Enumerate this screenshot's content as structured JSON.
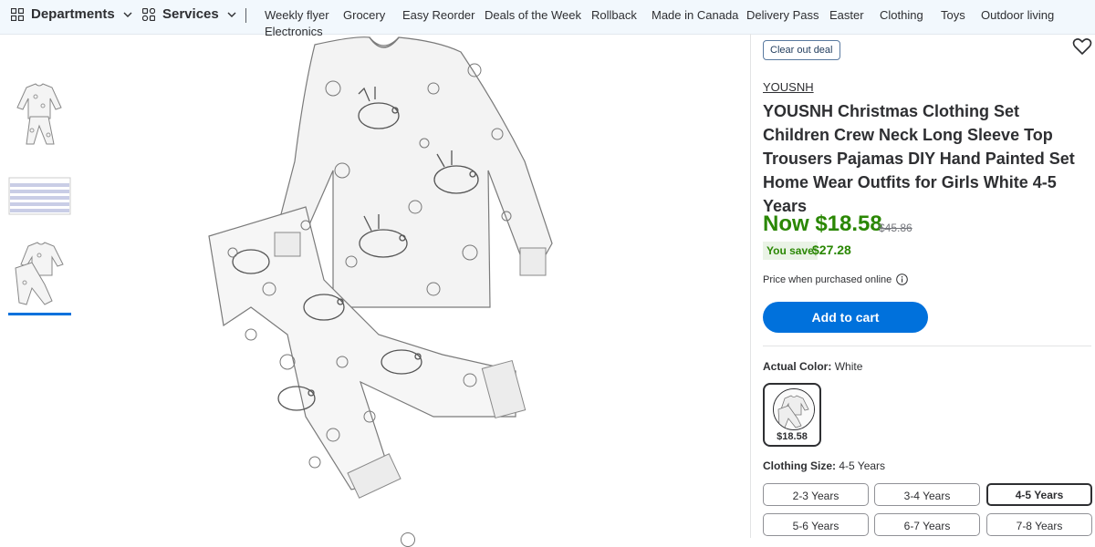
{
  "nav": {
    "departments": "Departments",
    "services": "Services",
    "links": [
      "Weekly flyer",
      "Grocery",
      "Easy Reorder",
      "Deals of the Week",
      "Rollback",
      "Made in Canada",
      "Delivery Pass",
      "Easter",
      "Clothing",
      "Toys",
      "Outdoor living",
      "Electronics"
    ]
  },
  "gallery": {
    "thumbnails": [
      "pajama-front",
      "size-chart",
      "pajama-set"
    ],
    "selected_index": 2
  },
  "product": {
    "badge": "Clear out deal",
    "brand": "YOUSNH",
    "title": "YOUSNH Christmas Clothing Set Children Crew Neck Long Sleeve Top Trousers Pajamas DIY Hand Painted Set Home Wear Outfits for Girls White 4-5 Years",
    "price_now": "Now $18.58",
    "price_was": "$45.86",
    "you_save_label": "You save",
    "you_save_amount": "$27.28",
    "price_note": "Price when purchased online",
    "add_to_cart": "Add to cart"
  },
  "color": {
    "label": "Actual Color:",
    "value": "White",
    "swatch_price": "$18.58"
  },
  "size": {
    "label": "Clothing Size:",
    "value": "4-5 Years",
    "options": [
      "2-3 Years",
      "3-4 Years",
      "4-5 Years",
      "5-6 Years",
      "6-7 Years",
      "7-8 Years"
    ],
    "selected": "4-5 Years"
  },
  "colors": {
    "accent": "#0071dc",
    "price_green": "#2a8703",
    "nav_bg": "#f2f8fd"
  }
}
